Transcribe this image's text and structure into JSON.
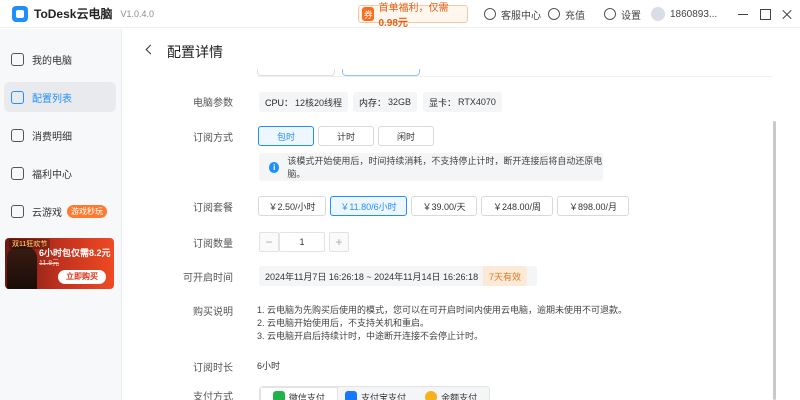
{
  "app": {
    "name": "ToDesk云电脑",
    "version": "V1.0.4.0"
  },
  "promo": {
    "badge": "券",
    "text": "首单福利，仅需",
    "price": "0.98元"
  },
  "titlebar": {
    "service": "客服中心",
    "recharge": "充值",
    "settings": "设置",
    "user": "1860893..."
  },
  "sidebar": {
    "items": [
      {
        "label": "我的电脑",
        "icon": "monitor-icon"
      },
      {
        "label": "配置列表",
        "icon": "list-icon",
        "active": true
      },
      {
        "label": "消费明细",
        "icon": "receipt-icon"
      },
      {
        "label": "福利中心",
        "icon": "gift-icon"
      },
      {
        "label": "云游戏",
        "icon": "gamepad-icon",
        "badge": "游戏秒玩"
      }
    ],
    "banner": {
      "tag": "双11狂欢节",
      "headline": "6小时包仅需",
      "price": "8.2元",
      "old_price": "11.8元",
      "button": "立即购买"
    }
  },
  "page": {
    "title": "配置详情"
  },
  "form": {
    "params_label": "电脑参数",
    "specs": [
      {
        "k": "CPU：",
        "v": "12核20线程"
      },
      {
        "k": "内存：",
        "v": "32GB"
      },
      {
        "k": "显卡：",
        "v": "RTX4070"
      }
    ],
    "sub_mode_label": "订阅方式",
    "sub_modes": [
      "包时",
      "计时",
      "闲时"
    ],
    "selected_mode": "包时",
    "notice": "该模式开始使用后，时间持续消耗，不支持停止计时，断开连接后将自动还原电脑。",
    "package_label": "订阅套餐",
    "packages": [
      "￥2.50/小时",
      "￥11.80/6小时",
      "￥39.00/天",
      "￥248.00/周",
      "￥898.00/月"
    ],
    "selected_package": "￥11.80/6小时",
    "qty_label": "订阅数量",
    "qty": "1",
    "open_time_label": "可开启时间",
    "open_time": "2024年11月7日 16:26:18 ~ 2024年11月14日 16:26:18",
    "open_time_tag": "7天有效",
    "purchase_label": "购买说明",
    "purchase_notes": [
      "1. 云电脑为先购买后使用的模式，您可以在可开启时间内使用云电脑，逾期未使用不可退款。",
      "2. 云电脑开始使用后，不支持关机和重启。",
      "3. 云电脑开启后持续计时，中途断开连接不会停止计时。"
    ],
    "duration_label": "订阅时长",
    "duration": "6小时",
    "pay_label": "支付方式",
    "pay_methods": [
      {
        "label": "微信支付",
        "color": "#22b24c"
      },
      {
        "label": "支付宝支付",
        "color": "#1677ff"
      },
      {
        "label": "余额支付",
        "color": "#f5b21a"
      }
    ]
  }
}
